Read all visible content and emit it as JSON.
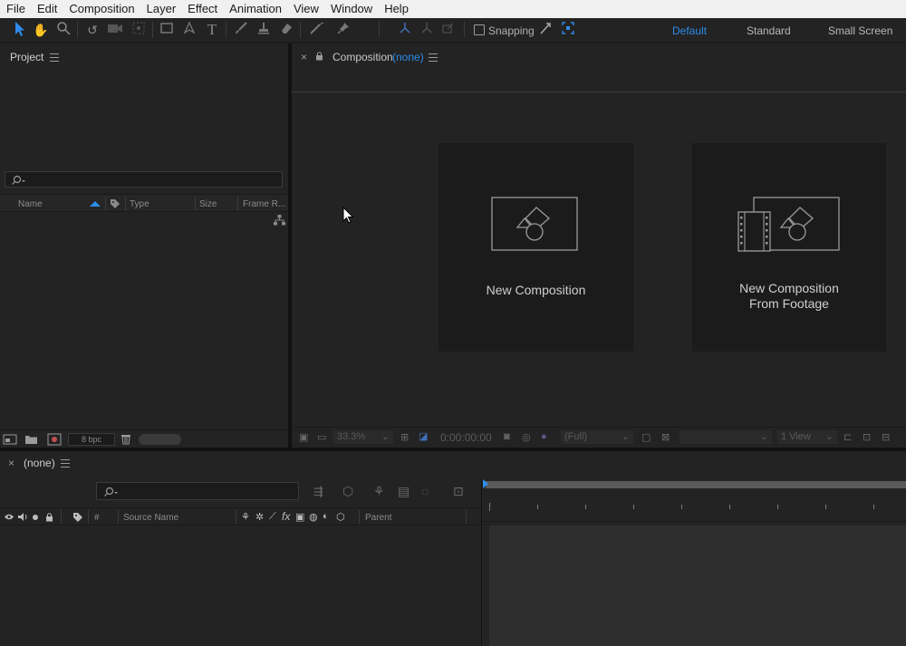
{
  "menu": [
    "File",
    "Edit",
    "Composition",
    "Layer",
    "Effect",
    "Animation",
    "View",
    "Window",
    "Help"
  ],
  "toolbar": {
    "snapping_label": "Snapping",
    "workspaces": [
      "Default",
      "Standard",
      "Small Screen"
    ],
    "active_workspace": "Default"
  },
  "project_panel": {
    "title": "Project",
    "columns": [
      "Name",
      "Type",
      "Size",
      "Frame R..."
    ],
    "bpc_label": "8 bpc"
  },
  "composition_panel": {
    "title": "Composition",
    "comp_name": "(none)",
    "cards": [
      {
        "label_lines": [
          "New Composition"
        ]
      },
      {
        "label_lines": [
          "New Composition",
          "From Footage"
        ]
      }
    ],
    "zoom": "33.3%",
    "timecode": "0:00:00:00",
    "resolution": "(Full)",
    "views": "1 View"
  },
  "timeline_panel": {
    "title": "(none)",
    "columns": [
      "#",
      "Source Name",
      "Parent"
    ]
  },
  "colors": {
    "accent": "#2d8ceb",
    "menubar_bg": "#f0f0f0",
    "panel_bg": "#232323",
    "dark_bg": "#1d1d1d",
    "card_bg": "#1b1b1b"
  }
}
